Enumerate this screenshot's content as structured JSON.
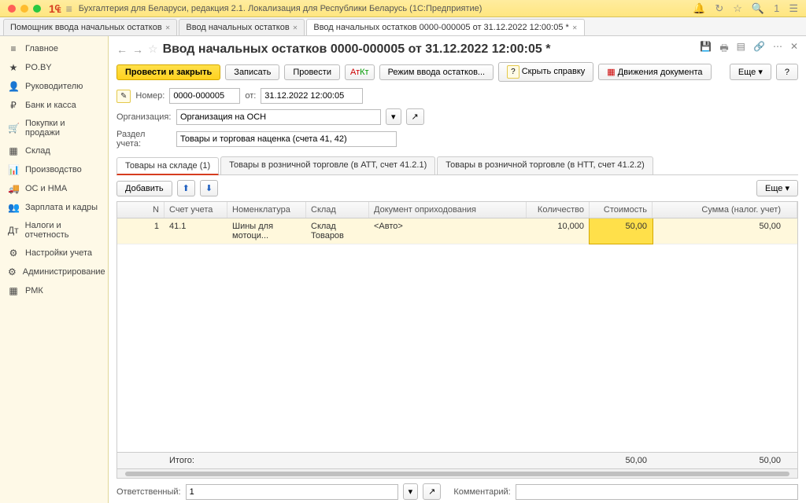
{
  "titlebar": {
    "app_title": "Бухгалтерия для Беларуси, редакция 2.1. Локализация для Республики Беларусь   (1С:Предприятие)"
  },
  "doc_tabs": [
    {
      "label": "Помощник ввода начальных остатков",
      "active": false
    },
    {
      "label": "Ввод начальных остатков",
      "active": false
    },
    {
      "label": "Ввод начальных остатков 0000-000005 от 31.12.2022 12:00:05 *",
      "active": true
    }
  ],
  "sidebar": [
    {
      "icon": "≡",
      "label": "Главное"
    },
    {
      "icon": "★",
      "label": "PO.BY"
    },
    {
      "icon": "👤",
      "label": "Руководителю"
    },
    {
      "icon": "₽",
      "label": "Банк и касса"
    },
    {
      "icon": "🛒",
      "label": "Покупки и продажи"
    },
    {
      "icon": "▦",
      "label": "Склад"
    },
    {
      "icon": "📊",
      "label": "Производство"
    },
    {
      "icon": "🚚",
      "label": "ОС и НМА"
    },
    {
      "icon": "👥",
      "label": "Зарплата и кадры"
    },
    {
      "icon": "Дт",
      "label": "Налоги и отчетность"
    },
    {
      "icon": "⚙",
      "label": "Настройки учета"
    },
    {
      "icon": "⚙",
      "label": "Администрирование"
    },
    {
      "icon": "▦",
      "label": "РМК"
    }
  ],
  "header": {
    "title": "Ввод начальных остатков 0000-000005 от 31.12.2022 12:00:05 *"
  },
  "toolbar": {
    "post_close": "Провести и закрыть",
    "save": "Записать",
    "post": "Провести",
    "mode": "Режим ввода остатков...",
    "hide_help": "Скрыть справку",
    "movements": "Движения документа",
    "more": "Еще",
    "help": "?"
  },
  "form": {
    "number_label": "Номер:",
    "number": "0000-000005",
    "date_label": "от:",
    "date": "31.12.2022 12:00:05",
    "org_label": "Организация:",
    "org": "Организация на ОСН",
    "section_label": "Раздел учета:",
    "section": "Товары и торговая наценка (счета 41, 42)"
  },
  "inner_tabs": [
    {
      "label": "Товары на складе (1)",
      "active": true
    },
    {
      "label": "Товары в розничной торговле (в АТТ, счет 41.2.1)",
      "active": false
    },
    {
      "label": "Товары в розничной торговле (в НТТ, счет 41.2.2)",
      "active": false
    }
  ],
  "table_toolbar": {
    "add": "Добавить",
    "more": "Еще"
  },
  "columns": {
    "n": "N",
    "account": "Счет учета",
    "nomenclature": "Номенклатура",
    "warehouse": "Склад",
    "doc": "Документ оприходования",
    "qty": "Количество",
    "cost": "Стоимость",
    "sum": "Сумма (налог. учет)"
  },
  "rows": [
    {
      "n": "1",
      "account": "41.1",
      "nomenclature": "Шины для мотоци...",
      "warehouse": "Склад Товаров",
      "doc": "<Авто>",
      "qty": "10,000",
      "cost": "50,00",
      "sum": "50,00"
    }
  ],
  "totals": {
    "label": "Итого:",
    "cost": "50,00",
    "sum": "50,00"
  },
  "footer": {
    "responsible_label": "Ответственный:",
    "responsible": "1",
    "comment_label": "Комментарий:",
    "comment": ""
  }
}
